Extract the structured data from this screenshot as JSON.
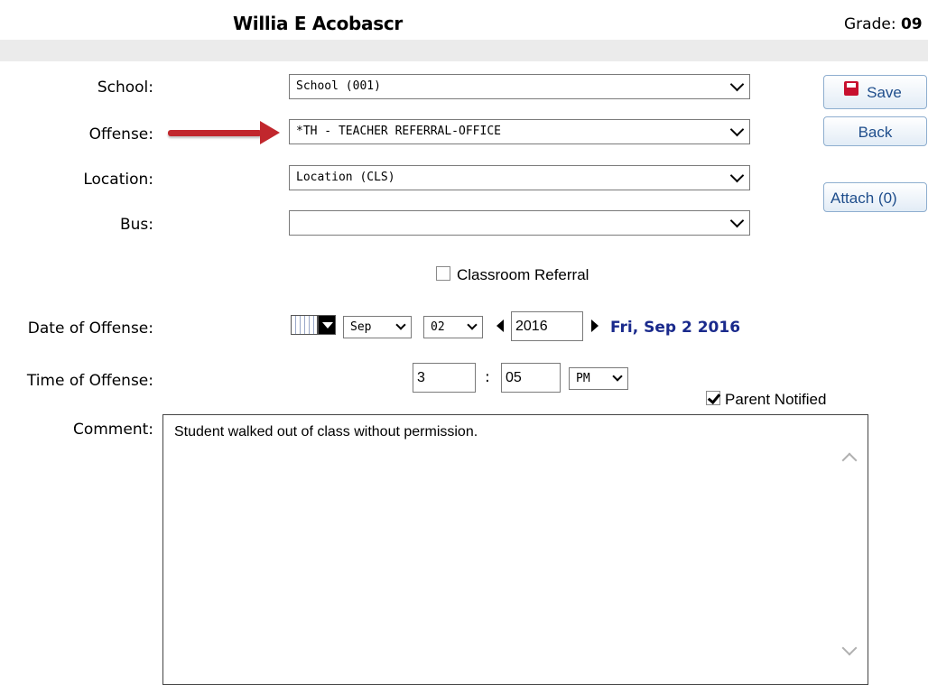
{
  "header": {
    "student_name": "Willia E Acobascr",
    "grade_label": "Grade:",
    "grade_value": "09"
  },
  "form": {
    "school": {
      "label": "School:",
      "value": "School (001)"
    },
    "offense": {
      "label": "Offense:",
      "value": "*TH - TEACHER REFERRAL-OFFICE"
    },
    "location": {
      "label": "Location:",
      "value": "Location (CLS)"
    },
    "bus": {
      "label": "Bus:",
      "value": ""
    },
    "classroom_referral": {
      "label": "Classroom Referral",
      "checked": false
    },
    "date_of_offense": {
      "label": "Date of Offense:",
      "month": "Sep",
      "day": "02",
      "year": "2016",
      "display": "Fri, Sep 2 2016"
    },
    "time_of_offense": {
      "label": "Time of Offense:",
      "hour": "3",
      "separator": ":",
      "minute": "05",
      "ampm": "PM"
    },
    "parent_notified": {
      "label": "Parent Notified",
      "checked": true
    },
    "comment": {
      "label": "Comment:",
      "value": "Student walked out of class without permission."
    }
  },
  "buttons": {
    "save": "Save",
    "back": "Back",
    "attach": "Attach (0)"
  },
  "colors": {
    "arrow": "#c1272d",
    "date_display": "#1a2a8c",
    "button_text": "#1f4e8c"
  }
}
